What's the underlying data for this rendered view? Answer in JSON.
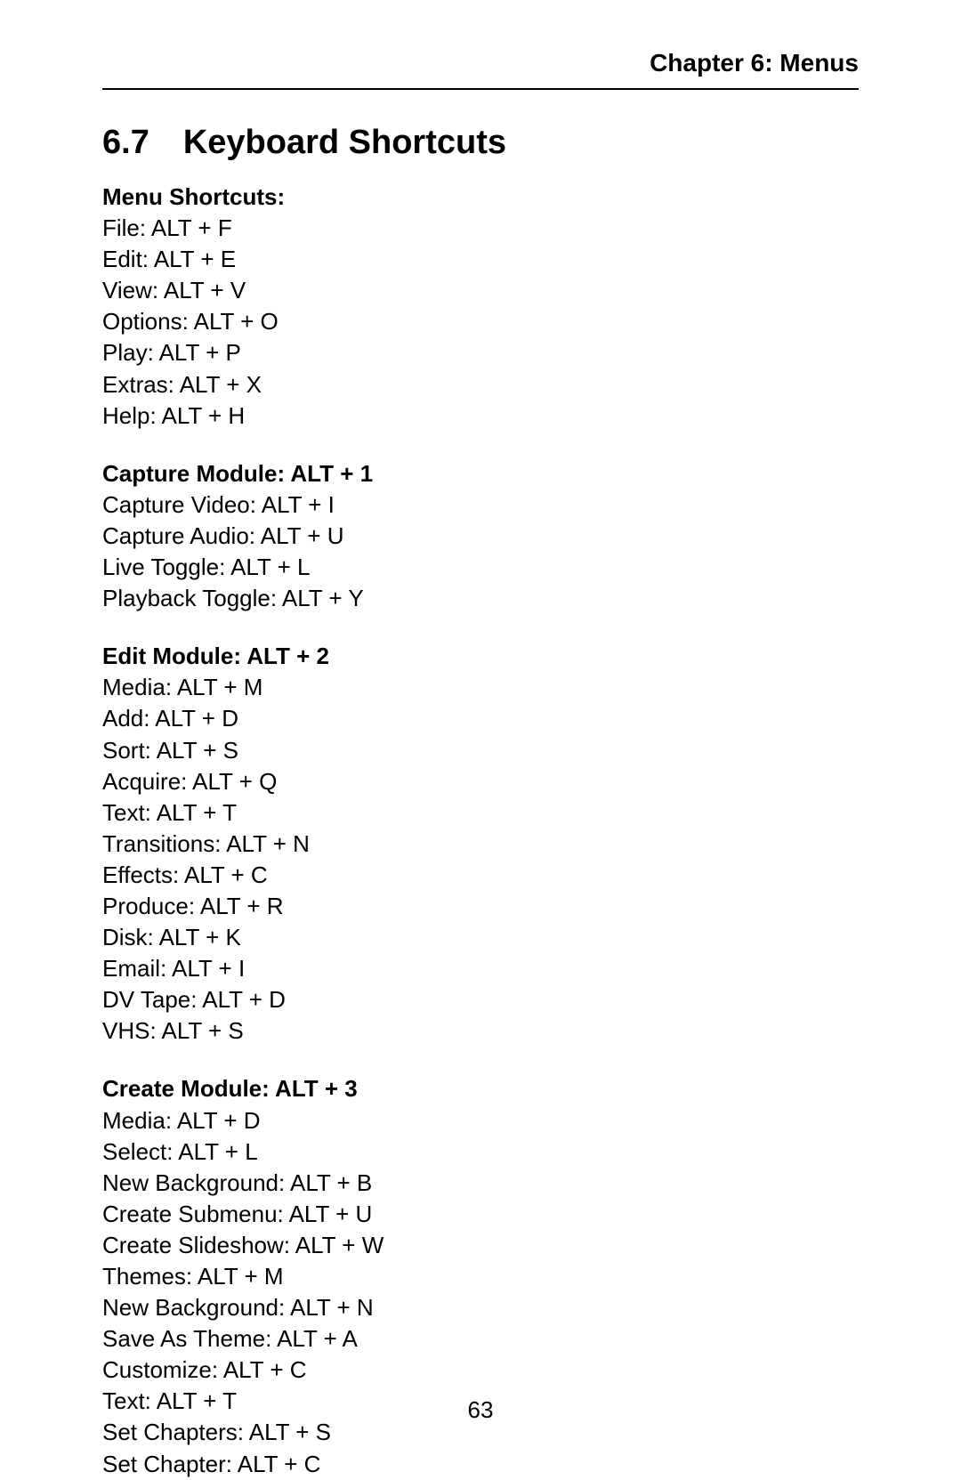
{
  "header": "Chapter 6:  Menus",
  "section_number": "6.7",
  "section_title": "Keyboard Shortcuts",
  "page_number": "63",
  "groups": [
    {
      "heading": "Menu Shortcuts:",
      "lines": [
        "File: ALT + F",
        "Edit: ALT + E",
        "View: ALT + V",
        "Options: ALT + O",
        "Play: ALT + P",
        "Extras: ALT + X",
        "Help: ALT + H"
      ]
    },
    {
      "heading": "Capture Module: ALT + 1",
      "lines": [
        "Capture Video: ALT + I",
        "Capture Audio: ALT + U",
        "Live Toggle: ALT + L",
        "Playback Toggle: ALT + Y"
      ]
    },
    {
      "heading": "Edit Module: ALT + 2",
      "lines": [
        "Media: ALT + M",
        "Add: ALT + D",
        "Sort: ALT + S",
        "Acquire: ALT + Q",
        "Text: ALT + T",
        "Transitions: ALT + N",
        "Effects: ALT + C",
        "Produce: ALT + R",
        "Disk: ALT + K",
        "Email: ALT + I",
        "DV Tape: ALT + D",
        "VHS: ALT + S"
      ]
    },
    {
      "heading": "Create Module: ALT + 3",
      "lines": [
        "Media: ALT + D",
        "Select: ALT + L",
        "New Background: ALT + B",
        "Create Submenu: ALT + U",
        "Create Slideshow: ALT + W",
        "Themes: ALT + M",
        "New Background: ALT + N",
        "Save As Theme: ALT + A",
        "Customize: ALT + C",
        "Text: ALT + T",
        "Set Chapters: ALT + S",
        "Set Chapter: ALT + C"
      ]
    }
  ]
}
